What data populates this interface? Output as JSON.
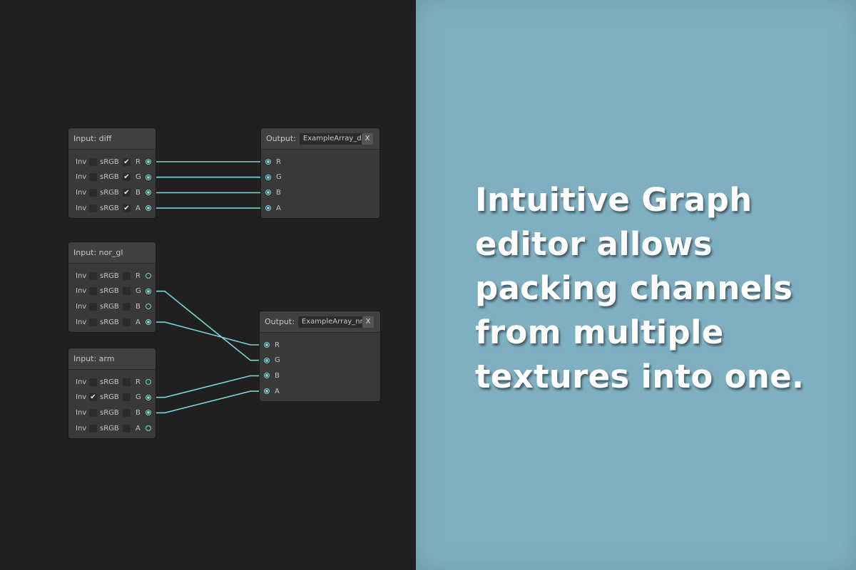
{
  "colors": {
    "wire": "#7ad3d6",
    "left_bg": "#202020",
    "right_bg": "#7fb0c2"
  },
  "inputs": [
    {
      "title": "Input: diff",
      "rows": [
        {
          "inv_label": "Inv",
          "inv_checked": false,
          "srgb_label": "sRGB",
          "srgb_checked": true,
          "channel": "R",
          "port_on": true
        },
        {
          "inv_label": "Inv",
          "inv_checked": false,
          "srgb_label": "sRGB",
          "srgb_checked": true,
          "channel": "G",
          "port_on": true
        },
        {
          "inv_label": "Inv",
          "inv_checked": false,
          "srgb_label": "sRGB",
          "srgb_checked": true,
          "channel": "B",
          "port_on": true
        },
        {
          "inv_label": "Inv",
          "inv_checked": false,
          "srgb_label": "sRGB",
          "srgb_checked": true,
          "channel": "A",
          "port_on": true
        }
      ]
    },
    {
      "title": "Input: nor_gl",
      "rows": [
        {
          "inv_label": "Inv",
          "inv_checked": false,
          "srgb_label": "sRGB",
          "srgb_checked": false,
          "channel": "R",
          "port_on": false
        },
        {
          "inv_label": "Inv",
          "inv_checked": false,
          "srgb_label": "sRGB",
          "srgb_checked": false,
          "channel": "G",
          "port_on": true
        },
        {
          "inv_label": "Inv",
          "inv_checked": false,
          "srgb_label": "sRGB",
          "srgb_checked": false,
          "channel": "B",
          "port_on": false
        },
        {
          "inv_label": "Inv",
          "inv_checked": false,
          "srgb_label": "sRGB",
          "srgb_checked": false,
          "channel": "A",
          "port_on": true
        }
      ]
    },
    {
      "title": "Input: arm",
      "rows": [
        {
          "inv_label": "Inv",
          "inv_checked": false,
          "srgb_label": "sRGB",
          "srgb_checked": false,
          "channel": "R",
          "port_on": false
        },
        {
          "inv_label": "Inv",
          "inv_checked": true,
          "srgb_label": "sRGB",
          "srgb_checked": false,
          "channel": "G",
          "port_on": true
        },
        {
          "inv_label": "Inv",
          "inv_checked": false,
          "srgb_label": "sRGB",
          "srgb_checked": false,
          "channel": "B",
          "port_on": true
        },
        {
          "inv_label": "Inv",
          "inv_checked": false,
          "srgb_label": "sRGB",
          "srgb_checked": false,
          "channel": "A",
          "port_on": false
        }
      ]
    }
  ],
  "outputs": [
    {
      "label": "Output:",
      "name": "ExampleArray_diff",
      "close_label": "X",
      "channels": [
        "R",
        "G",
        "B",
        "A"
      ]
    },
    {
      "label": "Output:",
      "name": "ExampleArray_nrm",
      "close_label": "X",
      "channels": [
        "R",
        "G",
        "B",
        "A"
      ]
    }
  ],
  "connections": [
    {
      "from": "diff.R",
      "to": "ExampleArray_diff.R"
    },
    {
      "from": "diff.G",
      "to": "ExampleArray_diff.G"
    },
    {
      "from": "diff.B",
      "to": "ExampleArray_diff.B"
    },
    {
      "from": "diff.A",
      "to": "ExampleArray_diff.A"
    },
    {
      "from": "nor_gl.G",
      "to": "ExampleArray_nrm.G"
    },
    {
      "from": "nor_gl.A",
      "to": "ExampleArray_nrm.R"
    },
    {
      "from": "arm.G",
      "to": "ExampleArray_nrm.B"
    },
    {
      "from": "arm.B",
      "to": "ExampleArray_nrm.A"
    }
  ],
  "promo": {
    "lines": [
      "Intuitive Graph",
      "editor allows",
      "packing channels",
      "from multiple",
      "textures into one."
    ]
  }
}
